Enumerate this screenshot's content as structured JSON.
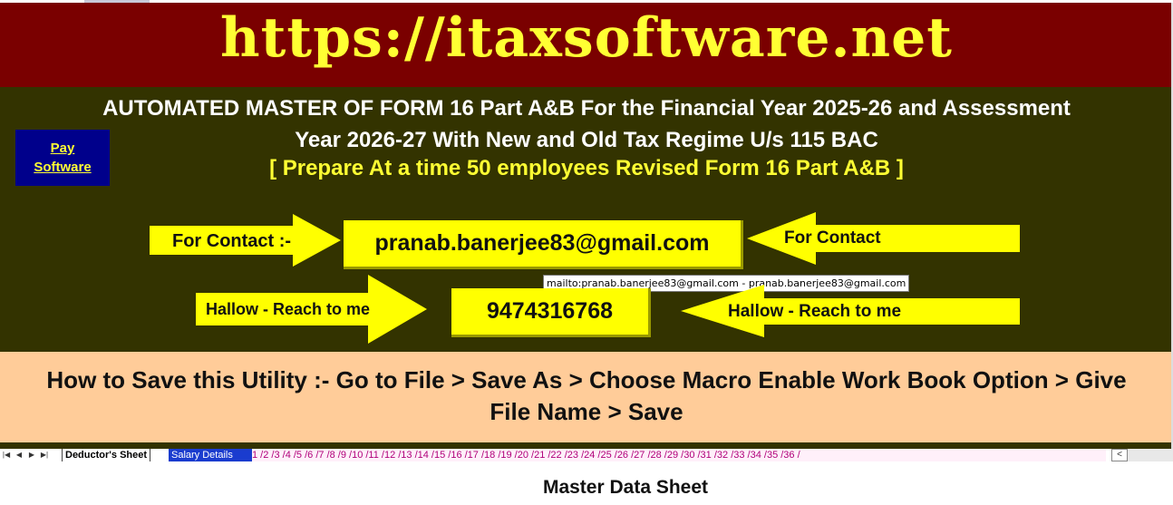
{
  "banner": {
    "url": "https://itaxsoftware.net"
  },
  "header": {
    "title_line1": "AUTOMATED MASTER OF FORM 16 Part A&B For the Financial Year 2025-26 and Assessment",
    "title_line2": "Year 2026-27  With New  and Old Tax Regime U/s 115 BAC",
    "subtitle": "[ Prepare At a time 50 employees Revised Form 16 Part A&B ]"
  },
  "pay_button": {
    "line1": "Pay",
    "line2": "Software"
  },
  "contact": {
    "left_label": "For Contact :-",
    "right_label": "For Contact",
    "email": "pranab.banerjee83@gmail.com",
    "tooltip": "mailto:pranab.banerjee83@gmail.com - pranab.banerjee83@gmail.com",
    "reach_left": "Hallow - Reach to me",
    "reach_right": "Hallow - Reach to me",
    "phone": "9474316768"
  },
  "howto": {
    "line1": "How to Save this Utility :- Go to File > Save As > Choose Macro Enable Work Book Option >   Give",
    "line2": "File Name > Save"
  },
  "sheet_tabs": {
    "active": "Deductor's Sheet",
    "salary": "Salary Details",
    "numbered": "1 /2 /3 /4 /5 /6 /7 /8 /9 /10 /11 /12 /13 /14 /15 /16 /17 /18 /19 /20 /21 /22 /23 /24 /25 /26 /27 /28 /29 /30 /31 /32 /33 /34 /35 /36 /"
  },
  "footer": {
    "title": "Master Data Sheet"
  },
  "colors": {
    "banner_bg": "#7a0000",
    "main_bg": "#333300",
    "accent_yellow": "#ffff00",
    "howto_bg": "#ffcc99",
    "pay_bg": "#00008b"
  }
}
